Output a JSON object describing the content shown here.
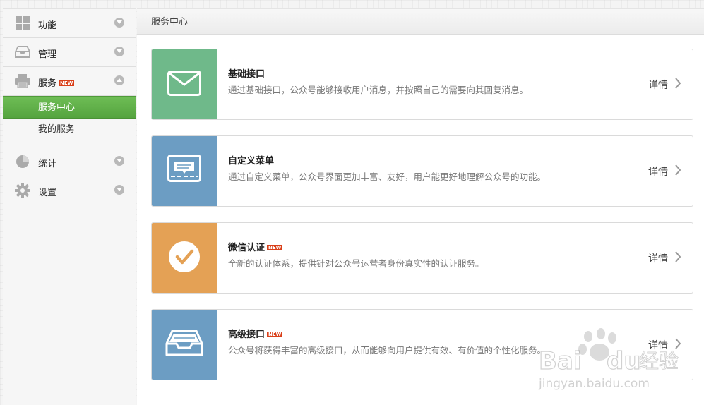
{
  "sidebar": {
    "groups": [
      {
        "label": "功能",
        "icon": "grid-icon",
        "state": "collapsed"
      },
      {
        "label": "管理",
        "icon": "inbox-icon",
        "state": "collapsed"
      },
      {
        "label": "服务",
        "icon": "printer-icon",
        "state": "expanded",
        "badge": "NEW",
        "children": [
          {
            "label": "服务中心",
            "active": true
          },
          {
            "label": "我的服务",
            "active": false
          }
        ]
      },
      {
        "label": "统计",
        "icon": "pie-chart-icon",
        "state": "collapsed"
      },
      {
        "label": "设置",
        "icon": "gear-icon",
        "state": "collapsed"
      }
    ]
  },
  "main": {
    "header": "服务中心",
    "cards": [
      {
        "title": "基础接口",
        "desc": "通过基础接口，公众号能够接收用户消息，并按照自己的需要向其回复消息。",
        "detail": "详情",
        "color": "#6fb98a",
        "icon": "envelope-icon",
        "badge": ""
      },
      {
        "title": "自定义菜单",
        "desc": "通过自定义菜单，公众号界面更加丰富、友好，用户能更好地理解公众号的功能。",
        "detail": "详情",
        "color": "#6c9dc3",
        "icon": "menu-screen-icon",
        "badge": ""
      },
      {
        "title": "微信认证",
        "desc": "全新的认证体系，提供针对公众号运营者身份真实性的认证服务。",
        "detail": "详情",
        "color": "#e4a155",
        "icon": "checkmark-icon",
        "badge": "NEW"
      },
      {
        "title": "高级接口",
        "desc": "公众号将获得丰富的高级接口，从而能够向用户提供有效、有价值的个性化服务。",
        "detail": "详情",
        "color": "#6c9dc3",
        "icon": "tray-icon",
        "badge": "NEW"
      }
    ]
  },
  "watermark": {
    "brand_left": "Bai",
    "brand_right": "du",
    "brand_cn": "经验",
    "url": "jingyan.baidu.com"
  }
}
